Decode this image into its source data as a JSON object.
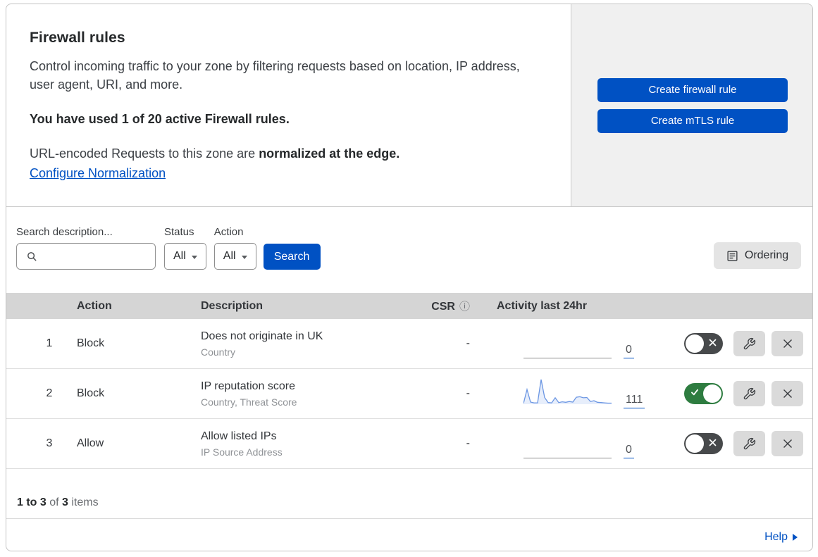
{
  "header": {
    "title": "Firewall rules",
    "description": "Control incoming traffic to your zone by filtering requests based on location, IP address, user agent, URI, and more.",
    "usage": "You have used 1 of 20 active Firewall rules.",
    "normalization_prefix": "URL-encoded Requests to this zone are ",
    "normalization_bold": "normalized at the edge.",
    "normalization_link": "Configure Normalization",
    "create_firewall_label": "Create firewall rule",
    "create_mtls_label": "Create mTLS rule"
  },
  "filters": {
    "search_label": "Search description...",
    "search_value": "",
    "status_label": "Status",
    "status_value": "All",
    "action_label": "Action",
    "action_value": "All",
    "search_button": "Search",
    "ordering_button": "Ordering"
  },
  "table": {
    "columns": {
      "action": "Action",
      "description": "Description",
      "csr": "CSR",
      "activity": "Activity last 24hr"
    },
    "rows": [
      {
        "index": "1",
        "action": "Block",
        "description": "Does not originate in UK",
        "fields": "Country",
        "csr": "-",
        "activity_count": "0",
        "enabled": false,
        "sparkline": null
      },
      {
        "index": "2",
        "action": "Block",
        "description": "IP reputation score",
        "fields": "Country, Threat Score",
        "csr": "-",
        "activity_count": "111",
        "enabled": true,
        "sparkline": [
          3,
          55,
          8,
          5,
          5,
          92,
          25,
          6,
          5,
          24,
          6,
          9,
          7,
          10,
          8,
          26,
          28,
          24,
          25,
          10,
          13,
          7,
          6,
          5,
          4,
          4
        ]
      },
      {
        "index": "3",
        "action": "Allow",
        "description": "Allow listed IPs",
        "fields": "IP Source Address",
        "csr": "-",
        "activity_count": "0",
        "enabled": false,
        "sparkline": null
      }
    ]
  },
  "footer": {
    "range_bold": "1 to 3",
    "of_text": "of",
    "total_bold": "3",
    "items_text": "items"
  },
  "help": {
    "label": "Help"
  },
  "colors": {
    "accent_blue": "#0051c3",
    "toggle_on": "#2e7c40",
    "toggle_off": "#47494b",
    "spark_line": "#6b96e3",
    "spark_fill": "#e7eefb"
  }
}
